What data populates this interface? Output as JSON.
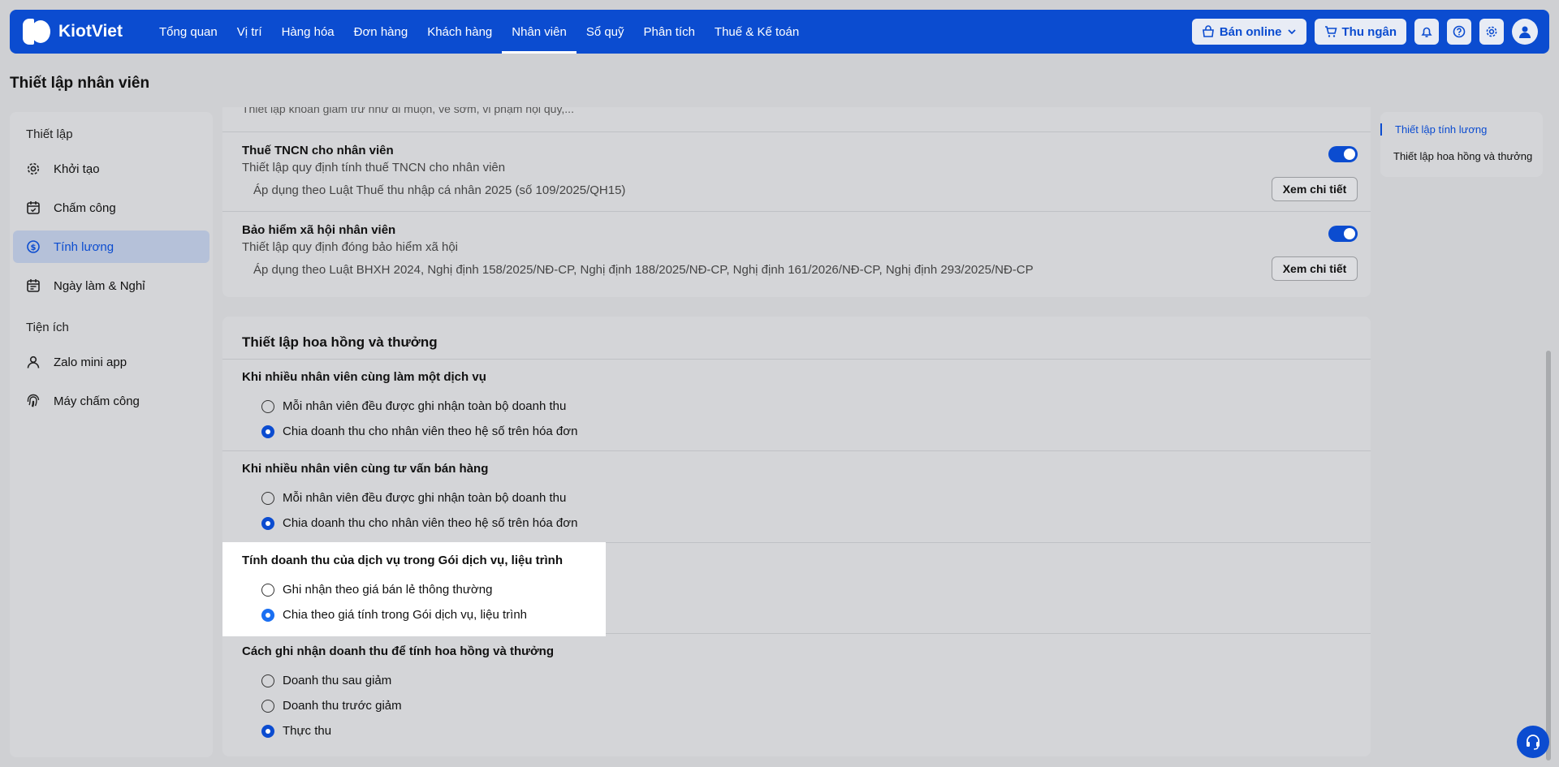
{
  "app": {
    "name": "KiotViet"
  },
  "nav": {
    "items": [
      {
        "label": "Tổng quan",
        "active": false
      },
      {
        "label": "Vị trí",
        "active": false
      },
      {
        "label": "Hàng hóa",
        "active": false
      },
      {
        "label": "Đơn hàng",
        "active": false
      },
      {
        "label": "Khách hàng",
        "active": false
      },
      {
        "label": "Nhân viên",
        "active": true
      },
      {
        "label": "Sổ quỹ",
        "active": false
      },
      {
        "label": "Phân tích",
        "active": false
      },
      {
        "label": "Thuế & Kế toán",
        "active": false
      }
    ],
    "sell_online": "Bán online",
    "cashier": "Thu ngân"
  },
  "page": {
    "title": "Thiết lập nhân viên"
  },
  "sidebar": {
    "group1": "Thiết lập",
    "items1": [
      {
        "label": "Khởi tạo",
        "icon": "gear-icon",
        "active": false
      },
      {
        "label": "Chấm công",
        "icon": "calendar-check-icon",
        "active": false
      },
      {
        "label": "Tính lương",
        "icon": "dollar-circle-icon",
        "active": true
      },
      {
        "label": "Ngày làm & Nghỉ",
        "icon": "calendar-icon",
        "active": false
      }
    ],
    "group2": "Tiện ích",
    "items2": [
      {
        "label": "Zalo mini app",
        "icon": "user-icon",
        "active": false
      },
      {
        "label": "Máy chấm công",
        "icon": "fingerprint-icon",
        "active": false
      }
    ]
  },
  "salary": {
    "cut_text": "Thiết lập khoản giảm trừ như đi muộn, về sớm, vi phạm nội quy,...",
    "tax": {
      "title": "Thuế TNCN cho nhân viên",
      "subtitle": "Thiết lập quy định tính thuế TNCN cho nhân viên",
      "note": "Áp dụng theo Luật Thuế thu nhập cá nhân 2025 (số 109/2025/QH15)",
      "button": "Xem chi tiết",
      "enabled": true
    },
    "insurance": {
      "title": "Bảo hiểm xã hội nhân viên",
      "subtitle": "Thiết lập quy định đóng bảo hiểm xã hội",
      "note": "Áp dụng theo Luật BHXH 2024, Nghị định 158/2025/NĐ-CP, Nghị định 188/2025/NĐ-CP, Nghị định 161/2026/NĐ-CP, Nghị định 293/2025/NĐ-CP",
      "button": "Xem chi tiết",
      "enabled": true
    }
  },
  "commission": {
    "title": "Thiết lập hoa hồng và thưởng",
    "groups": [
      {
        "title": "Khi nhiều nhân viên cùng làm một dịch vụ",
        "options": [
          {
            "label": "Mỗi nhân viên đều được ghi nhận toàn bộ doanh thu",
            "checked": false
          },
          {
            "label": "Chia doanh thu cho nhân viên theo hệ số trên hóa đơn",
            "checked": true
          }
        ]
      },
      {
        "title": "Khi nhiều nhân viên cùng tư vấn bán hàng",
        "options": [
          {
            "label": "Mỗi nhân viên đều được ghi nhận toàn bộ doanh thu",
            "checked": false
          },
          {
            "label": "Chia doanh thu cho nhân viên theo hệ số trên hóa đơn",
            "checked": true
          }
        ]
      },
      {
        "title": "Tính doanh thu của dịch vụ trong Gói dịch vụ, liệu trình",
        "options": [
          {
            "label": "Ghi nhận theo giá bán lẻ thông thường",
            "checked": false
          },
          {
            "label": "Chia theo giá tính trong Gói dịch vụ, liệu trình",
            "checked": true
          }
        ]
      },
      {
        "title": "Cách ghi nhận doanh thu để tính hoa hồng và thưởng",
        "options": [
          {
            "label": "Doanh thu sau giảm",
            "checked": false
          },
          {
            "label": "Doanh thu trước giảm",
            "checked": false
          },
          {
            "label": "Thực thu",
            "checked": true
          }
        ]
      }
    ]
  },
  "rightnav": {
    "items": [
      {
        "label": "Thiết lập tính lương",
        "active": true
      },
      {
        "label": "Thiết lập hoa hồng và thưởng",
        "active": false
      }
    ]
  }
}
